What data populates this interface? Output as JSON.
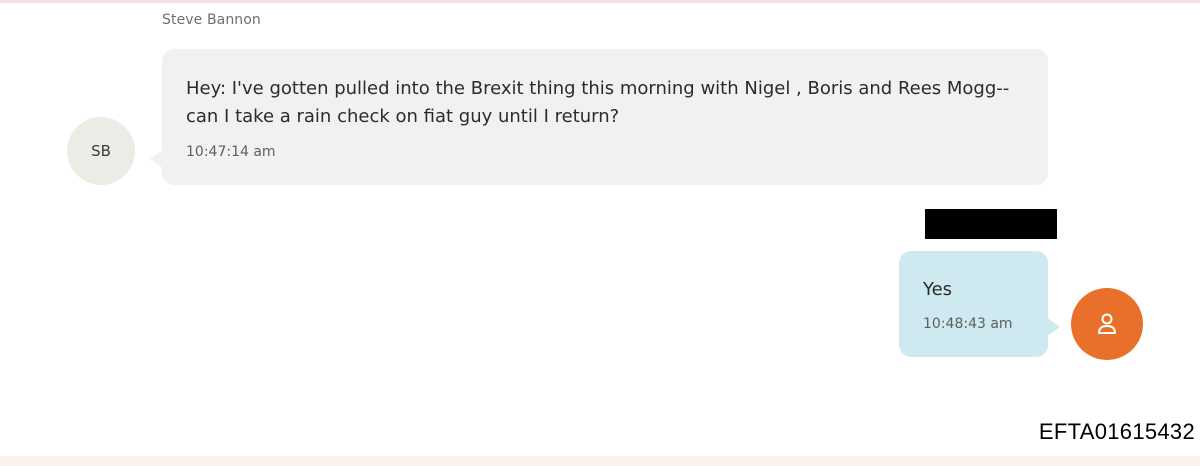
{
  "colors": {
    "incoming_bubble": "#f1f1ef",
    "outgoing_bubble": "#cfe9f0",
    "user_avatar": "#e8702a",
    "initials_avatar": "#ecece6",
    "redaction": "#000000"
  },
  "messages": [
    {
      "direction": "incoming",
      "sender": "Steve Bannon",
      "avatar_initials": "SB",
      "text": "Hey: I've gotten pulled into the Brexit thing this morning with Nigel , Boris and Rees Mogg-- can  I take a rain check on fiat guy until I return?",
      "time": "10:47:14 am"
    },
    {
      "direction": "outgoing",
      "sender_redacted": true,
      "avatar_icon": "person-icon",
      "text": "Yes",
      "time": "10:48:43 am"
    }
  ],
  "document_id": "EFTA01615432"
}
